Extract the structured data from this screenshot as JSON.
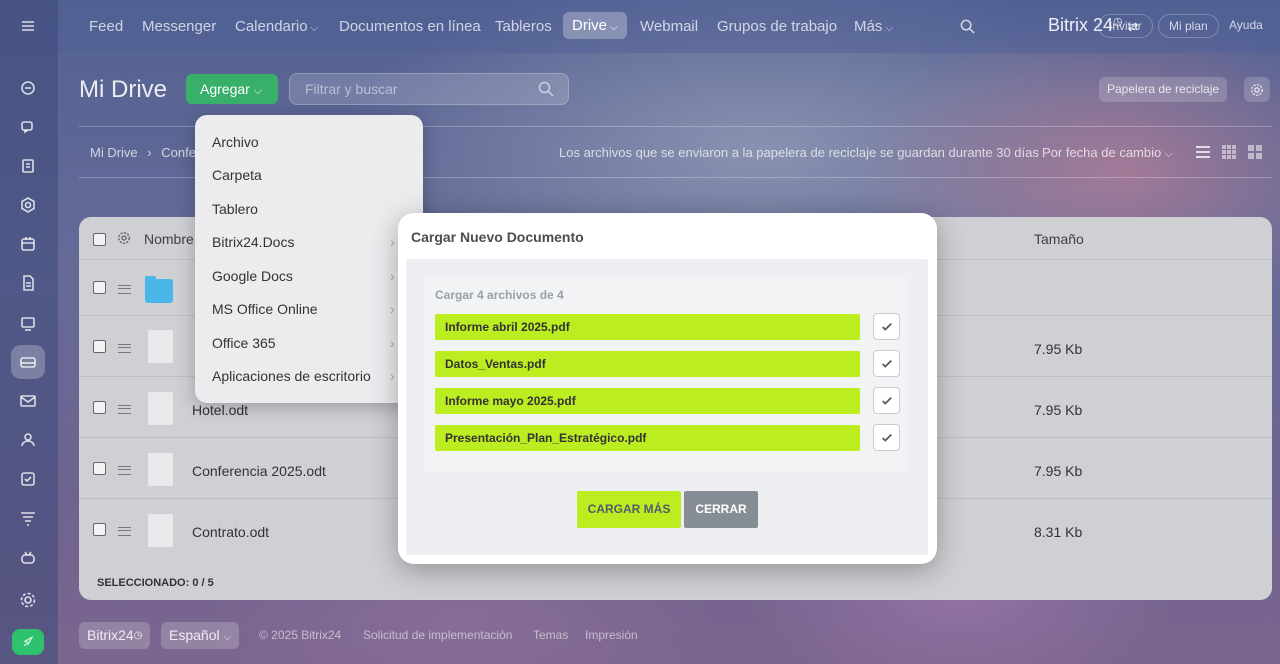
{
  "topnav": {
    "items": [
      "Feed",
      "Messenger",
      "Calendario",
      "Documentos en línea",
      "Tableros",
      "Drive",
      "Webmail",
      "Grupos de trabajo",
      "Más"
    ],
    "brand": "Bitrix 24",
    "invite": "Invitar",
    "plan": "Mi plan",
    "help": "Ayuda"
  },
  "page": {
    "title": "Mi Drive",
    "add_button": "Agregar",
    "search_placeholder": "Filtrar y buscar",
    "trash_button": "Papelera de reciclaje",
    "breadcrumb_root": "Mi Drive",
    "breadcrumb_current": "Confe",
    "notice": "Los archivos que se enviaron a la papelera de reciclaje se guardan durante 30 días",
    "sort_label": "Por fecha de cambio"
  },
  "table": {
    "col_name": "Nombre",
    "col_size": "Tamaño",
    "rows": [
      {
        "name": "",
        "size": "",
        "type": "folder"
      },
      {
        "name": "",
        "size": "7.95 Kb",
        "type": "file"
      },
      {
        "name": "Hotel.odt",
        "size": "7.95 Kb",
        "type": "file"
      },
      {
        "name": "Conferencia 2025.odt",
        "size": "7.95 Kb",
        "type": "file"
      },
      {
        "name": "Contrato.odt",
        "size": "8.31 Kb",
        "type": "file"
      }
    ],
    "selected_label": "SELECCIONADO:",
    "selected_value": "0 / 5"
  },
  "add_menu": {
    "items": [
      "Archivo",
      "Carpeta",
      "Tablero",
      "Bitrix24.Docs",
      "Google Docs",
      "MS Office Online",
      "Office 365",
      "Aplicaciones de escritorio"
    ]
  },
  "modal": {
    "title": "Cargar Nuevo Documento",
    "count_label": "Cargar 4 archivos de 4",
    "files": [
      "Informe abril 2025.pdf",
      "Datos_Ventas.pdf",
      "Informe mayo 2025.pdf",
      "Presentación_Plan_Estratégico.pdf"
    ],
    "upload_more": "CARGAR MÁS",
    "close": "CERRAR"
  },
  "footer": {
    "brand": "Bitrix24",
    "language": "Español",
    "copyright": "© 2025 Bitrix24",
    "impl_request": "Solicitud de implementación",
    "themes": "Temas",
    "print": "Impresión"
  },
  "colors": {
    "accent_green": "#39b06a",
    "upload_lime": "#bbed21",
    "close_gray": "#868d95"
  }
}
